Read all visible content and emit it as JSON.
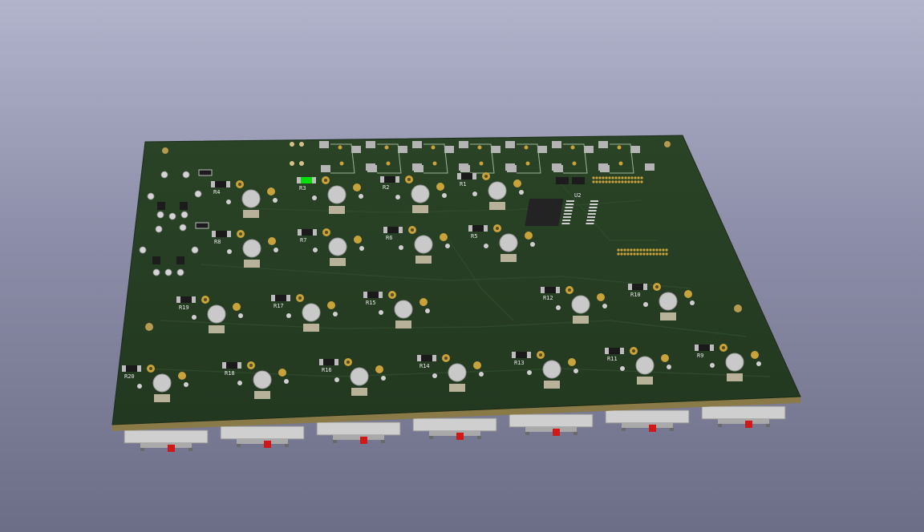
{
  "window": {
    "title": ""
  },
  "pcb": {
    "colors": {
      "background_top": "#b2b4cc",
      "background_bottom": "#6c6d86",
      "board": "#243a22",
      "board_edge": "#8a7a48",
      "pad_gold": "#c8a23a",
      "silkscreen": "#e8e8e8",
      "highlight": "#00e000",
      "switch_body": "#cfcfcf",
      "switch_actuator": "#d01818"
    },
    "ic_label": "U2",
    "resistors": [
      {
        "ref": "R4"
      },
      {
        "ref": "R3",
        "highlighted": true
      },
      {
        "ref": "R2"
      },
      {
        "ref": "R1"
      },
      {
        "ref": "R8"
      },
      {
        "ref": "R7"
      },
      {
        "ref": "R6"
      },
      {
        "ref": "R5"
      },
      {
        "ref": "R19"
      },
      {
        "ref": "R17"
      },
      {
        "ref": "R15"
      },
      {
        "ref": "R12"
      },
      {
        "ref": "R10"
      },
      {
        "ref": "R20"
      },
      {
        "ref": "R18"
      },
      {
        "ref": "R16"
      },
      {
        "ref": "R14"
      },
      {
        "ref": "R13"
      },
      {
        "ref": "R11"
      },
      {
        "ref": "R9"
      }
    ],
    "switch_count": 7
  }
}
